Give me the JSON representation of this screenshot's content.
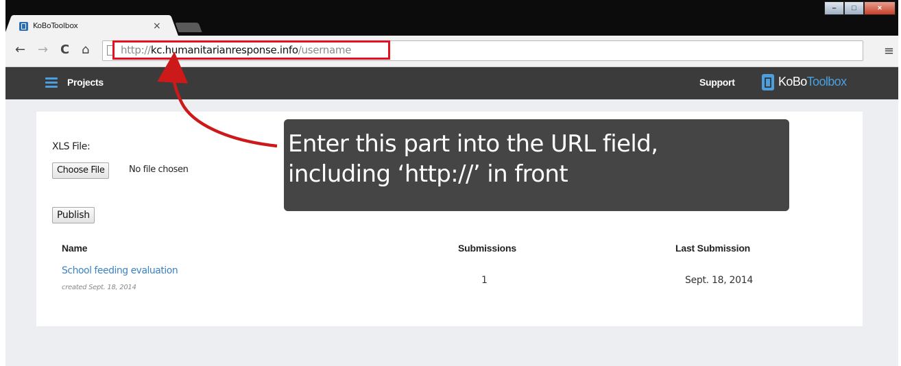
{
  "browser": {
    "tab_title": "KoBoToolbox",
    "tab_close": "×",
    "nav": {
      "back": "←",
      "forward": "→",
      "reload": "C",
      "home": "⌂"
    },
    "url": {
      "scheme": "http://",
      "host": "kc.humanitarianresponse.info",
      "path": "/username"
    },
    "menu": "≡",
    "window_buttons": {
      "minimize": "–",
      "maximize": "□",
      "close": "×"
    }
  },
  "appbar": {
    "projects_label": "Projects",
    "support_label": "Support",
    "brand_part1": "KoBo",
    "brand_part2": "Toolbox",
    "accent_color": "#4a9fe0"
  },
  "form": {
    "xls_label": "XLS File:",
    "choose_file_label": "Choose File",
    "no_file_text": "No file chosen",
    "publish_label": "Publish"
  },
  "table": {
    "headers": [
      "Name",
      "Submissions",
      "Last Submission"
    ],
    "rows": [
      {
        "name": "School feeding evaluation",
        "created": "created Sept. 18, 2014",
        "submissions": "1",
        "last_submission": "Sept. 18, 2014"
      }
    ]
  },
  "annotation": {
    "line1": "Enter this part into the URL field,",
    "line2": "including ‘http://’ in front",
    "highlight_color": "#e8101e"
  }
}
